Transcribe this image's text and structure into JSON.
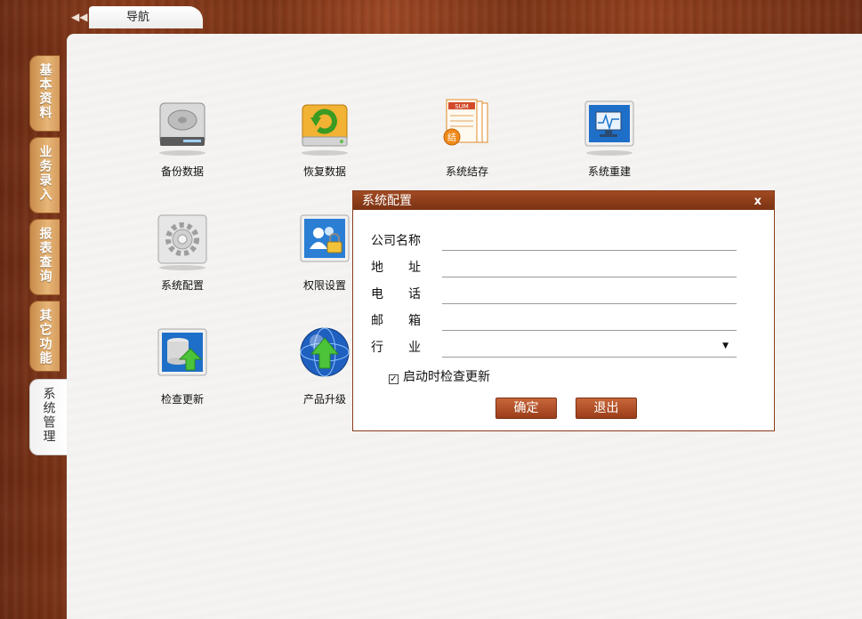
{
  "nav": {
    "collapse_icon": "double-chevron-left-icon",
    "collapse_glyph": "◀◀",
    "tab_label": "导航"
  },
  "side_tabs": [
    {
      "label": "基本资料"
    },
    {
      "label": "业务录入"
    },
    {
      "label": "报表查询"
    },
    {
      "label": "其它功能"
    },
    {
      "label": "系统管理"
    }
  ],
  "apps": [
    {
      "label": "备份数据",
      "icon": "hard-drive-icon"
    },
    {
      "label": "恢复数据",
      "icon": "restore-drive-icon"
    },
    {
      "label": "系统结存",
      "icon": "sum-documents-icon"
    },
    {
      "label": "系统重建",
      "icon": "monitor-rebuild-icon"
    },
    {
      "label": "系统配置",
      "icon": "gear-icon"
    },
    {
      "label": "权限设置",
      "icon": "user-permission-icon"
    },
    {
      "label": "检查更新",
      "icon": "database-upload-icon"
    },
    {
      "label": "产品升级",
      "icon": "globe-upgrade-icon"
    }
  ],
  "dialog": {
    "title": "系统配置",
    "close_glyph": "x",
    "fields": {
      "company_label": "公司名称",
      "company_value": "",
      "address_label": "地　　址",
      "address_value": "",
      "phone_label": "电　　话",
      "phone_value": "",
      "email_label": "邮　　箱",
      "email_value": "",
      "industry_label": "行　　业",
      "industry_value": ""
    },
    "dropdown_glyph": "▼",
    "check_mark": "✓",
    "check_label": "启动时检查更新",
    "ok_label": "确定",
    "exit_label": "退出"
  },
  "colors": {
    "accent": "#8a3c1c",
    "button": "#b55430",
    "wood": "#7c3315"
  }
}
